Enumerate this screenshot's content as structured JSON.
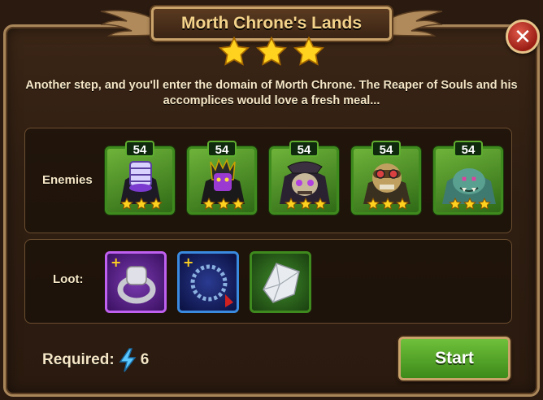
{
  "dialog": {
    "title": "Morth Chrone's Lands",
    "stars": 3,
    "description": "Another step, and you'll enter the domain of Morth Chrone. The Reaper of Souls and his accomplices would love a fresh meal...",
    "close_icon": "close-icon"
  },
  "enemies": {
    "label": "Enemies",
    "items": [
      {
        "name": "reaper-enemy",
        "level": "54",
        "stars": 3
      },
      {
        "name": "dark-king-enemy",
        "level": "54",
        "stars": 3
      },
      {
        "name": "skull-beast-enemy",
        "level": "54",
        "stars": 3
      },
      {
        "name": "goggled-skeleton-enemy",
        "level": "54",
        "stars": 3
      },
      {
        "name": "green-troll-enemy",
        "level": "54",
        "stars": 3
      }
    ]
  },
  "loot": {
    "label": "Loot:",
    "items": [
      {
        "name": "silver-ring-fragment",
        "frame_color": "#8a3fc0"
      },
      {
        "name": "pearl-necklace-fragment",
        "frame_color": "#2f6fc0"
      },
      {
        "name": "crystal-shard",
        "frame_color": "#3f8a1e"
      }
    ]
  },
  "requirement": {
    "label": "Required:",
    "icon": "energy-bolt-icon",
    "value": "6"
  },
  "start_button": {
    "label": "Start"
  },
  "colors": {
    "gold_text": "#f3d28a",
    "star_gold": "#ffd21f",
    "frame_gold": "#c9a36a",
    "green_button": "#4f9e26"
  }
}
